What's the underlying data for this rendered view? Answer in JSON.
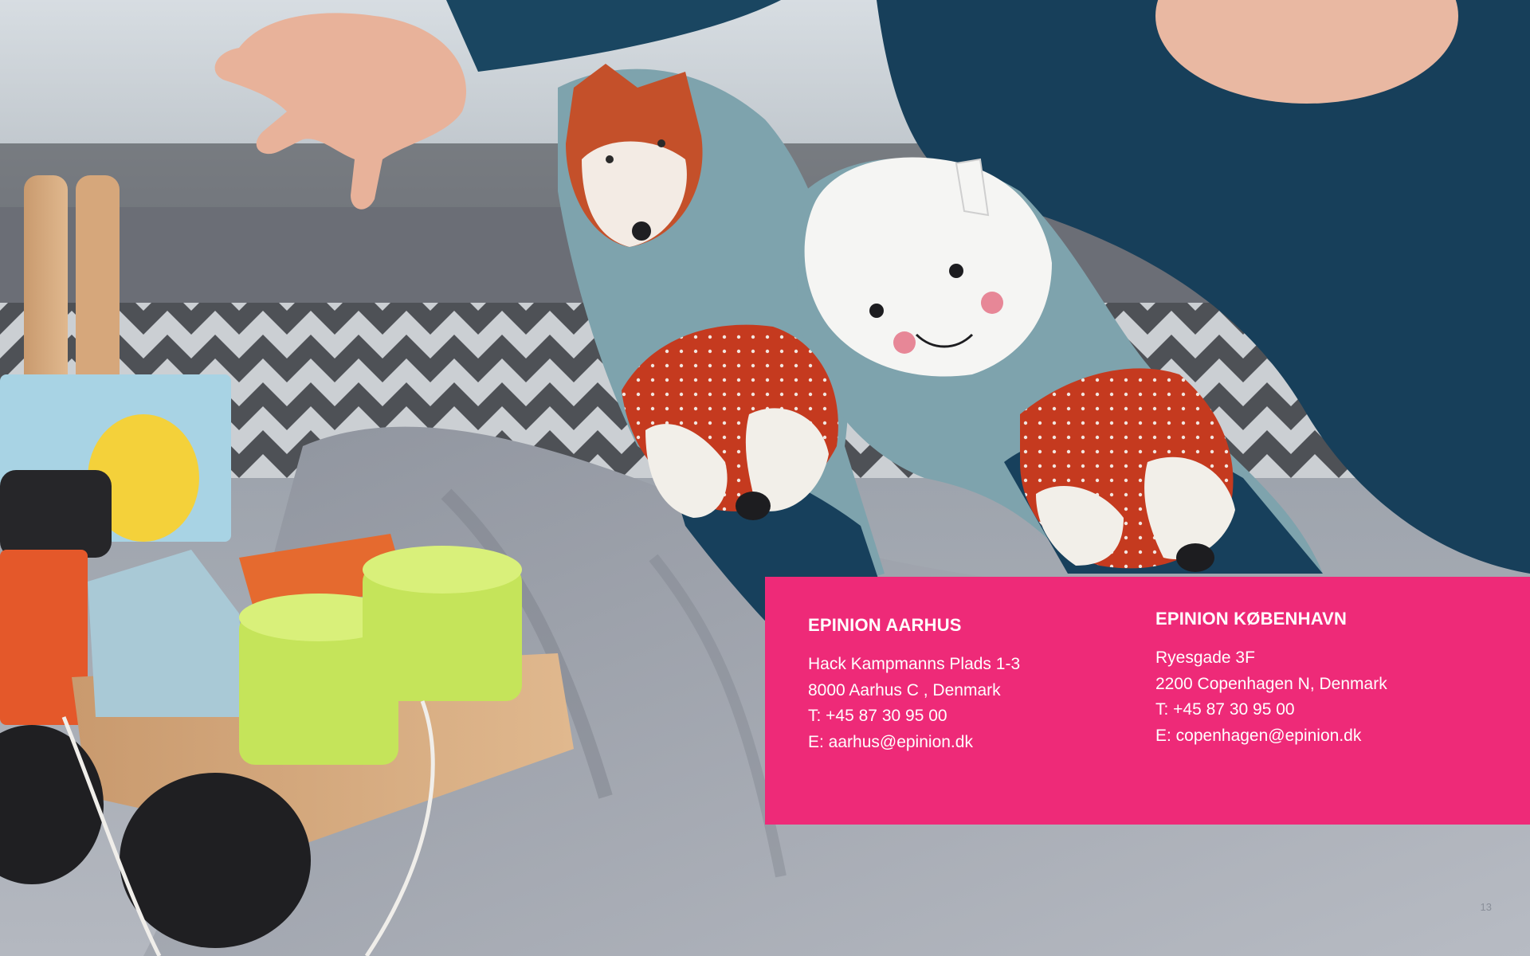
{
  "offices": {
    "aarhus": {
      "title": "EPINION AARHUS",
      "address_line1": "Hack Kampmanns Plads 1-3",
      "address_line2": "8000 Aarhus C , Denmark",
      "phone": "T: +45 87 30 95 00",
      "email": "E: aarhus@epinion.dk"
    },
    "copenhagen": {
      "title": "EPINION KØBENHAVN",
      "address_line1": "Ryesgade 3F",
      "address_line2": "2200 Copenhagen N, Denmark",
      "phone": "T: +45 87 30 95 00",
      "email": "E: copenhagen@epinion.dk"
    }
  },
  "page": {
    "number": "13"
  },
  "colors": {
    "panel": "#ee2a78",
    "text": "#ffffff"
  },
  "image": {
    "subject": "child-with-wooden-toys-photo"
  }
}
